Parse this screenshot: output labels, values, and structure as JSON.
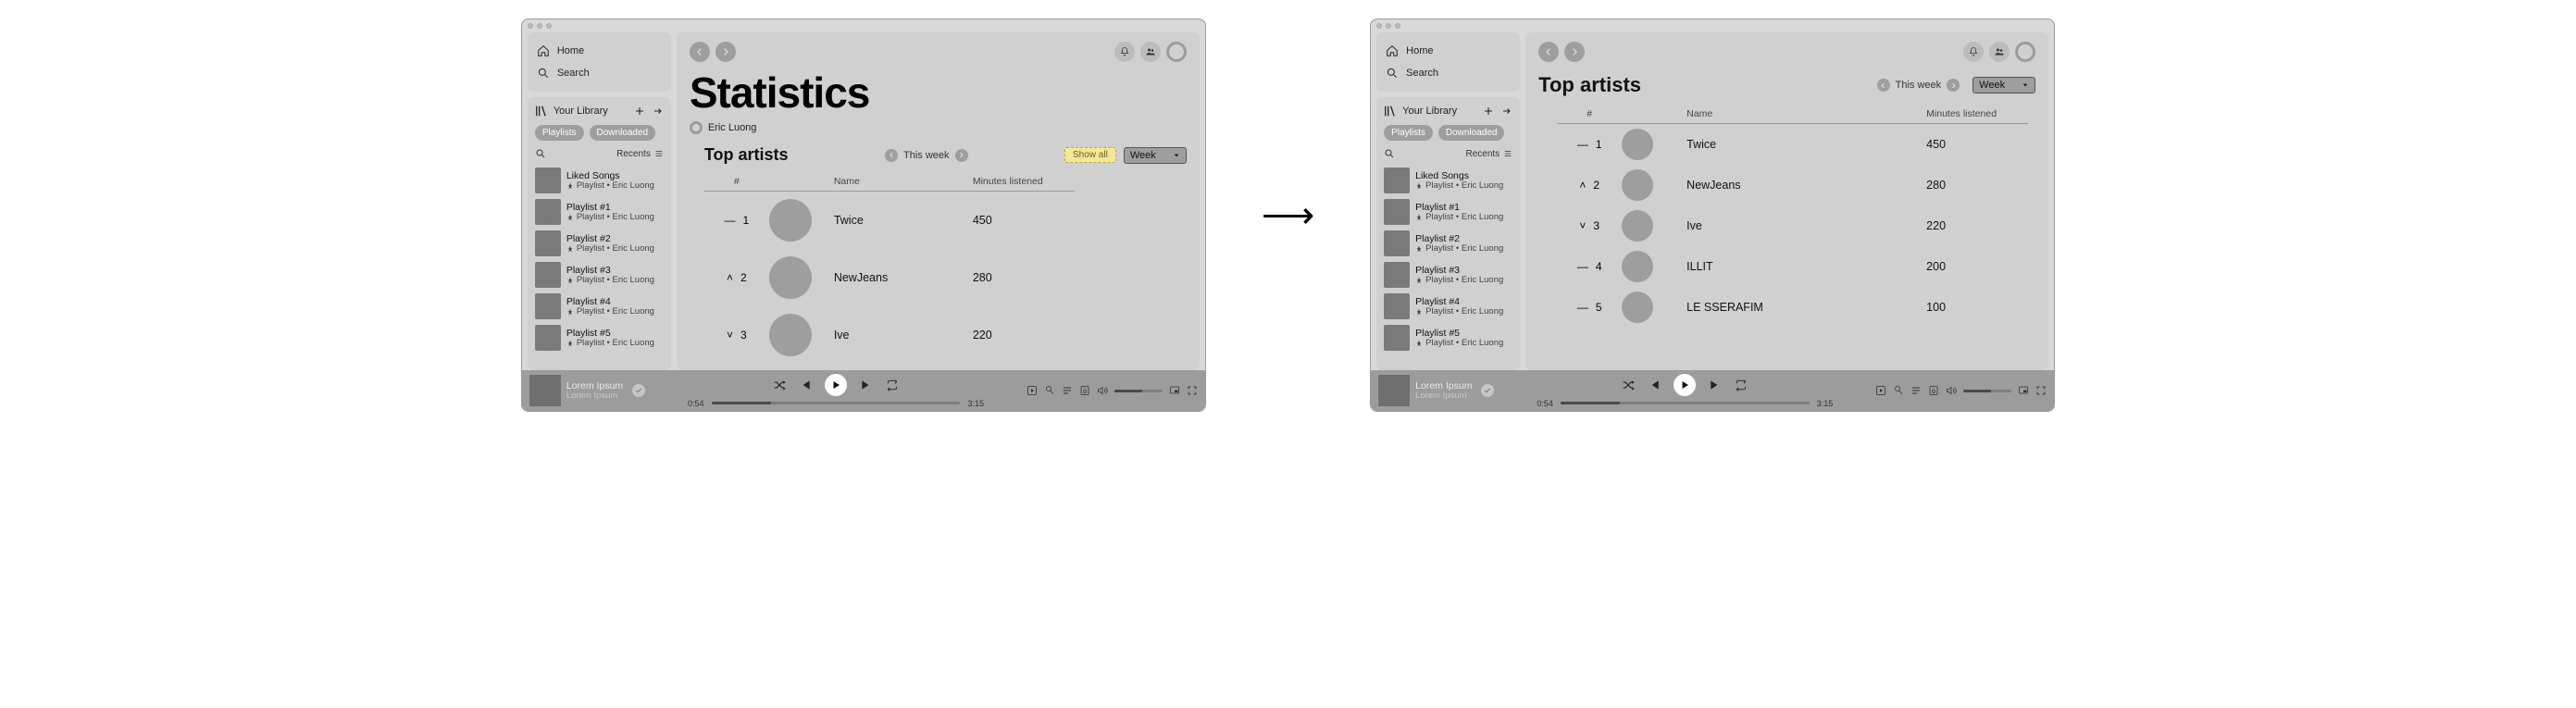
{
  "nav": {
    "home": "Home",
    "search": "Search"
  },
  "library": {
    "title": "Your Library",
    "chips": [
      "Playlists",
      "Downloaded"
    ],
    "recents": "Recents",
    "items": [
      {
        "name": "Liked Songs",
        "sub": "Playlist • Eric Luong"
      },
      {
        "name": "Playlist #1",
        "sub": "Playlist • Eric Luong"
      },
      {
        "name": "Playlist #2",
        "sub": "Playlist • Eric Luong"
      },
      {
        "name": "Playlist #3",
        "sub": "Playlist • Eric Luong"
      },
      {
        "name": "Playlist #4",
        "sub": "Playlist • Eric Luong"
      },
      {
        "name": "Playlist #5",
        "sub": "Playlist • Eric Luong"
      }
    ]
  },
  "statistics": {
    "title": "Statistics",
    "author": "Eric Luong",
    "section_title": "Top artists",
    "week_label": "This week",
    "show_all": "Show all",
    "dropdown": "Week",
    "columns": {
      "rank": "#",
      "name": "Name",
      "minutes": "Minutes listened"
    },
    "rows_preview": [
      {
        "trend": "—",
        "rank": "1",
        "name": "Twice",
        "minutes": "450"
      },
      {
        "trend": "˄",
        "rank": "2",
        "name": "NewJeans",
        "minutes": "280"
      },
      {
        "trend": "˅",
        "rank": "3",
        "name": "Ive",
        "minutes": "220"
      }
    ],
    "rows_full": [
      {
        "trend": "—",
        "rank": "1",
        "name": "Twice",
        "minutes": "450"
      },
      {
        "trend": "˄",
        "rank": "2",
        "name": "NewJeans",
        "minutes": "280"
      },
      {
        "trend": "˅",
        "rank": "3",
        "name": "Ive",
        "minutes": "220"
      },
      {
        "trend": "—",
        "rank": "4",
        "name": "ILLIT",
        "minutes": "200"
      },
      {
        "trend": "—",
        "rank": "5",
        "name": "LE SSERAFIM",
        "minutes": "100"
      }
    ]
  },
  "player": {
    "title": "Lorem Ipsum",
    "subtitle": "Lorem Ipsum",
    "elapsed": "0:54",
    "total": "3:15"
  }
}
